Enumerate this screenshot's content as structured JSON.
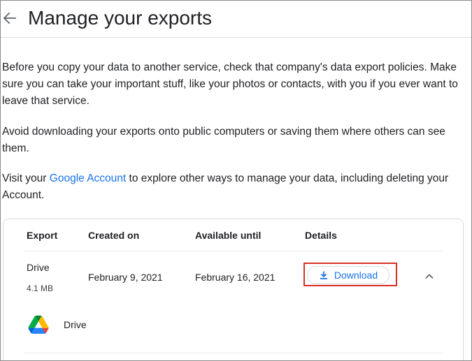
{
  "header": {
    "title": "Manage your exports"
  },
  "intro": {
    "paragraph_1": "Before you copy your data to another service, check that company's data export policies. Make sure you can take your important stuff, like your photos or contacts, with you if you ever want to leave that service.",
    "paragraph_2": "Avoid downloading your exports onto public computers or saving them where others can see them.",
    "paragraph_3_before": "Visit your ",
    "paragraph_3_link": "Google Account",
    "paragraph_3_after": " to explore other ways to manage your data, including deleting your Account."
  },
  "table": {
    "columns": [
      "Export",
      "Created on",
      "Available until",
      "Details"
    ],
    "rows": [
      {
        "name": "Drive",
        "size": "4.1 MB",
        "created_on": "February 9, 2021",
        "available_until": "February 16, 2021",
        "download_label": "Download",
        "products": [
          "Drive"
        ]
      }
    ]
  },
  "icons": {
    "back": "arrow-back-icon",
    "download": "download-icon",
    "expand": "chevron-up-icon",
    "product": "google-drive-logo"
  },
  "colors": {
    "link": "#1a73e8",
    "highlight": "#d93025",
    "text": "#202124"
  }
}
